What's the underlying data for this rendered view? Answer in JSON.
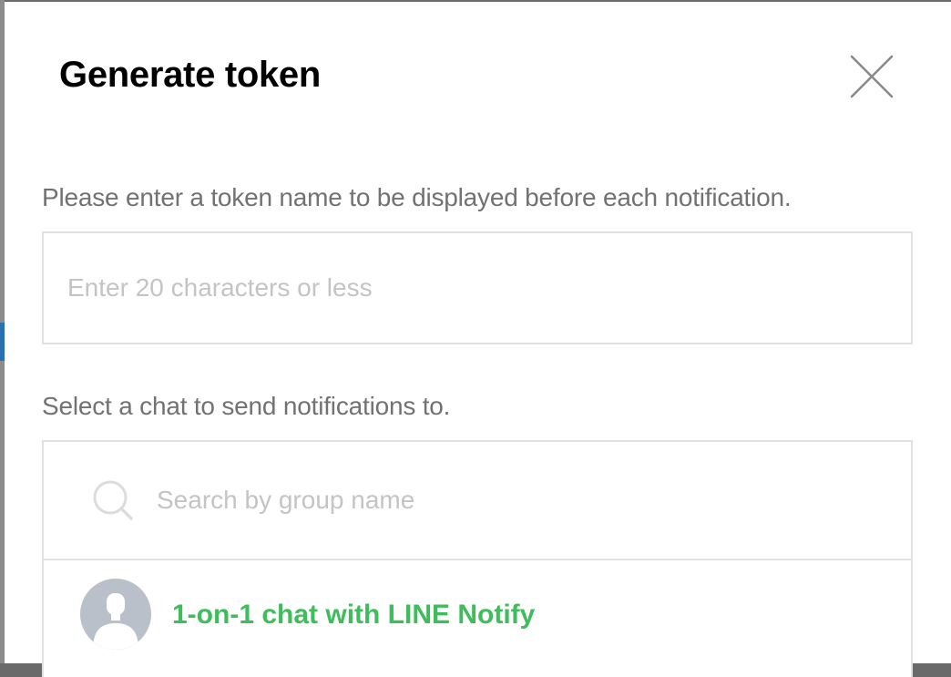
{
  "dialog": {
    "title": "Generate token",
    "close_icon": "close-icon"
  },
  "token_name": {
    "label": "Please enter a token name to be displayed before each notification.",
    "value": "",
    "placeholder": "Enter 20 characters or less"
  },
  "chat_select": {
    "label": "Select a chat to send notifications to.",
    "search": {
      "icon": "search-icon",
      "value": "",
      "placeholder": "Search by group name"
    },
    "items": [
      {
        "name": "1-on-1 chat with LINE Notify",
        "avatar_icon": "user-avatar-icon"
      }
    ]
  },
  "colors": {
    "accent_green": "#3fbd5c",
    "label_gray": "#727272",
    "placeholder_gray": "#c4c4c4",
    "border_gray": "#e1e1e1",
    "avatar_bg": "#b9c0ca"
  }
}
